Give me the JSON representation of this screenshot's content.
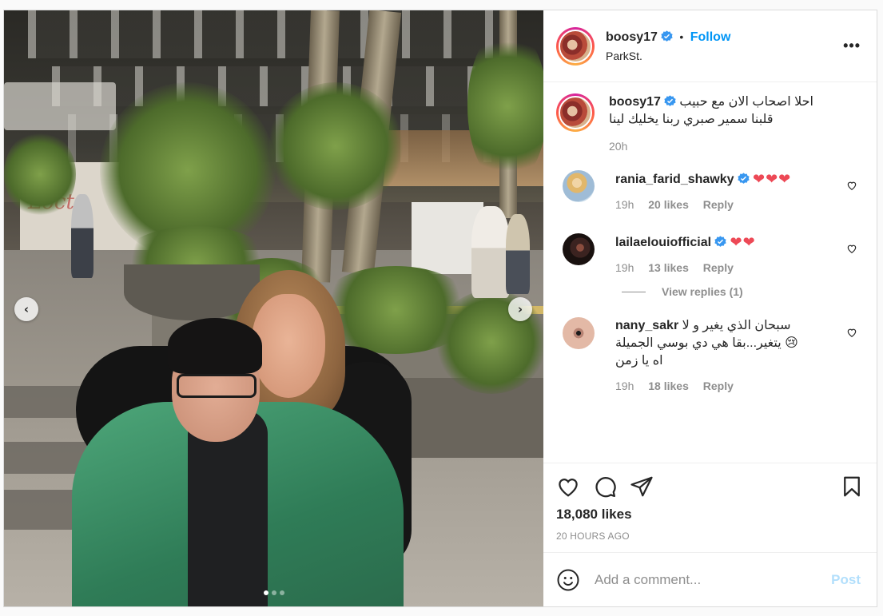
{
  "post": {
    "author": {
      "username": "boosy17",
      "verified": true,
      "location": "ParkSt.",
      "follow_label": "Follow",
      "follow_sep": "•"
    },
    "more_label": "•••",
    "media": {
      "wall_text": "Locte",
      "nav_prev": "‹",
      "nav_next": "›",
      "carousel": {
        "count": 3,
        "active_index": 0
      },
      "icons": [
        "chevron-left-icon",
        "chevron-right-icon"
      ]
    },
    "caption": {
      "username": "boosy17",
      "line1": "احلا اصحاب الان مع حبيب",
      "line2": "قلبنا سمير صبري ربنا يخليك لينا",
      "time": "20h"
    },
    "comments": [
      {
        "username": "rania_farid_shawky",
        "verified": true,
        "text": "",
        "emoji": "❤❤❤",
        "time": "19h",
        "likes": "20 likes",
        "reply": "Reply"
      },
      {
        "username": "lailaelouiofficial",
        "verified": true,
        "text": "",
        "emoji": "❤❤",
        "time": "19h",
        "likes": "13 likes",
        "reply": "Reply",
        "view_replies": "View replies (1)"
      },
      {
        "username": "nany_sakr",
        "verified": false,
        "line1": "سبحان الذي يغير و لا",
        "line2": "يتغير...بقا هي دي بوسي الجميلة",
        "emoji2": "😢",
        "line3": "اه يا زمن",
        "time": "19h",
        "likes": "18 likes",
        "reply": "Reply"
      }
    ],
    "likes_count": "18,080 likes",
    "posted_ago": "20 HOURS AGO",
    "add_comment": {
      "placeholder": "Add a comment...",
      "post_label": "Post"
    },
    "icons": [
      "heart-icon",
      "comment-icon",
      "share-icon",
      "bookmark-icon",
      "emoji-icon",
      "verified-badge-icon"
    ],
    "colors": {
      "accent": "#0095f6",
      "post_disabled": "#b2dffc",
      "heart_red": "#ed4956",
      "muted": "#8e8e8e",
      "text": "#262626"
    }
  }
}
